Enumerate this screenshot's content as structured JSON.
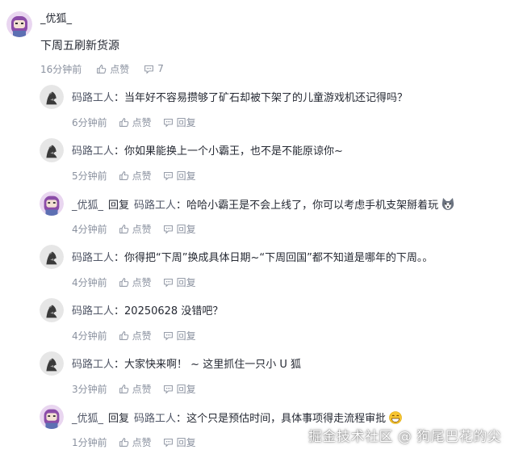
{
  "post": {
    "author": "_优狐_",
    "content": "下周五刷新货源",
    "time": "16分钟前",
    "like_label": "点赞",
    "comment_count": "7"
  },
  "replies": [
    {
      "author": "码路工人",
      "reply_to": "",
      "sep": "：",
      "text": "当年好不容易攒够了矿石却被下架了的儿童游戏机还记得吗？",
      "time": "6分钟前",
      "like_label": "点赞",
      "reply_label": "回复",
      "avatar": "dark"
    },
    {
      "author": "码路工人",
      "reply_to": "",
      "sep": "：",
      "text": "你如果能换上一个小霸王，也不是不能原谅你~",
      "time": "5分钟前",
      "like_label": "点赞",
      "reply_label": "回复",
      "avatar": "dark"
    },
    {
      "author": "_优狐_",
      "reply_word": "回复",
      "reply_to": "码路工人",
      "sep": "：",
      "text": "哈哈小霸王是不会上线了，你可以考虑手机支架掰着玩",
      "time": "4分钟前",
      "like_label": "点赞",
      "reply_label": "回复",
      "avatar": "purple",
      "emoji": "husky-emoji"
    },
    {
      "author": "码路工人",
      "reply_to": "",
      "sep": "：",
      "text": "你得把“下周”换成具体日期~“下周回国”都不知道是哪年的下周。。",
      "time": "4分钟前",
      "like_label": "点赞",
      "reply_label": "回复",
      "avatar": "dark"
    },
    {
      "author": "码路工人",
      "reply_to": "",
      "sep": "：",
      "text": "20250628 没错吧？",
      "time": "4分钟前",
      "like_label": "点赞",
      "reply_label": "回复",
      "avatar": "dark"
    },
    {
      "author": "码路工人",
      "reply_to": "",
      "sep": "：",
      "text": "大家快来啊！ ~ 这里抓住一只小 U 狐",
      "time": "3分钟前",
      "like_label": "点赞",
      "reply_label": "回复",
      "avatar": "dark"
    },
    {
      "author": "_优狐_",
      "reply_word": "回复",
      "reply_to": "码路工人",
      "sep": "：",
      "text": "这个只是预估时间，具体事项得走流程审批",
      "time": "1分钟前",
      "like_label": "点赞",
      "reply_label": "回复",
      "avatar": "purple",
      "emoji": "grin-emoji"
    }
  ],
  "watermark": "掘金技术社区 @ 狗尾巴花的尖",
  "colors": {
    "text": "#252933",
    "meta": "#8a919f",
    "avatar_purple": "#8b4ca8"
  }
}
